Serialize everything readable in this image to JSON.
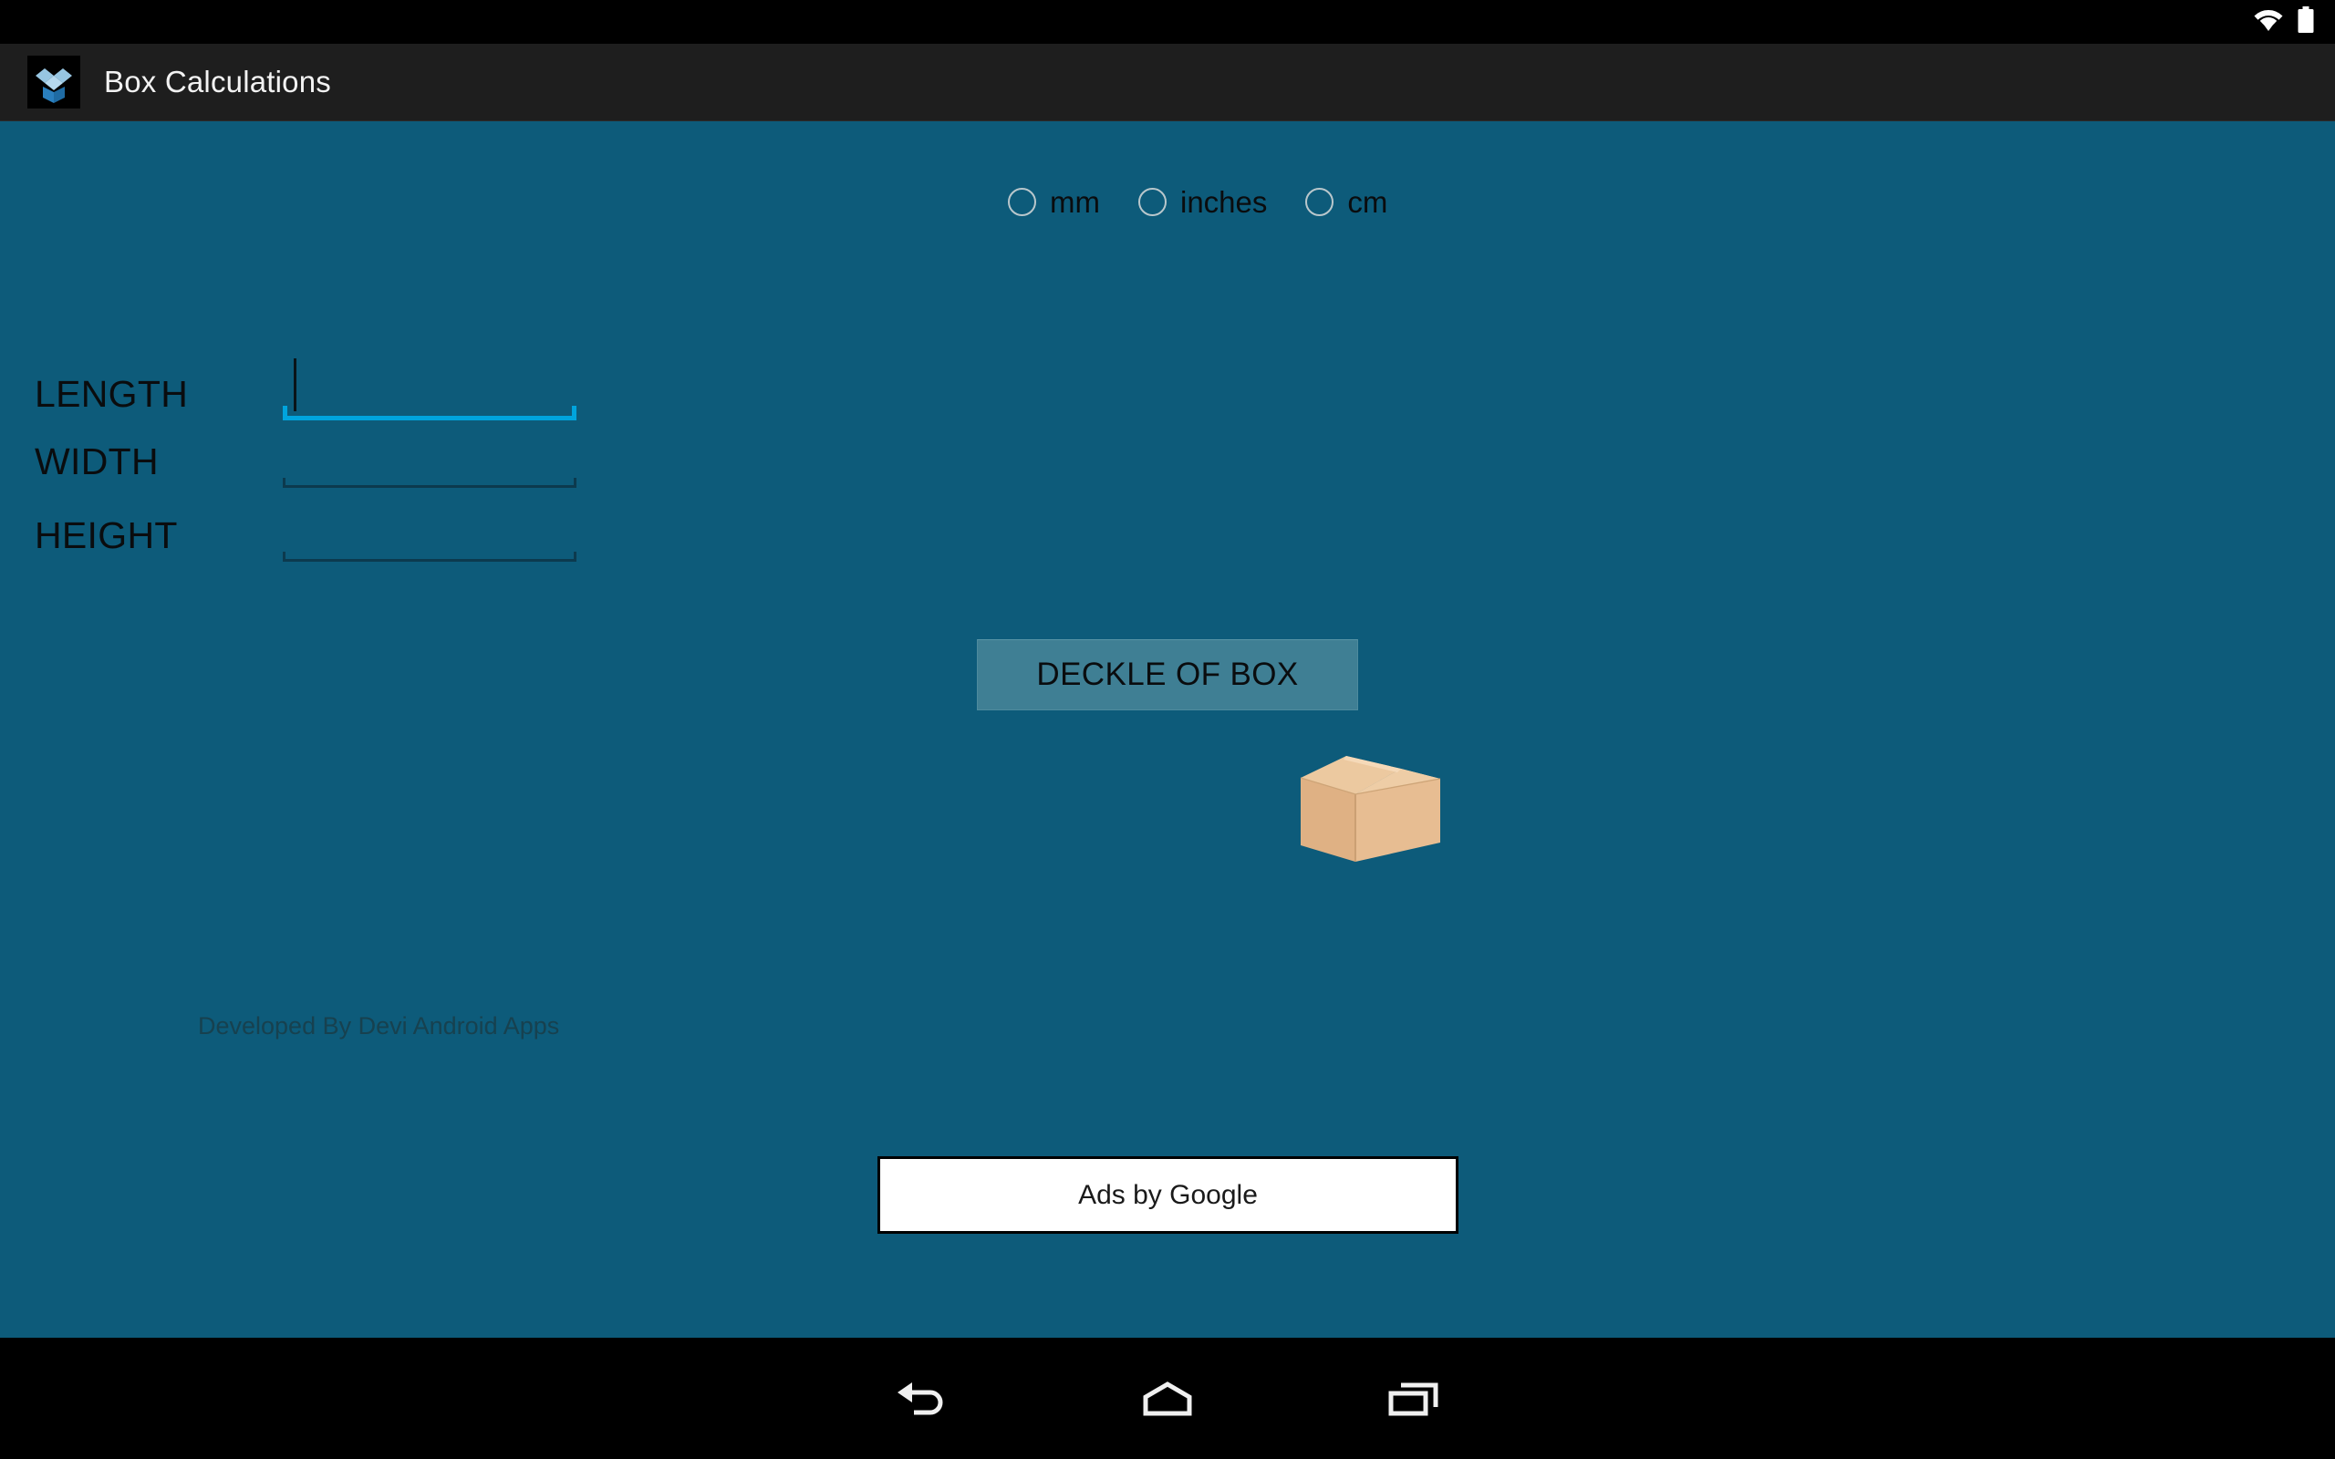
{
  "status_bar": {
    "wifi_icon": "wifi-icon",
    "battery_icon": "battery-full-icon"
  },
  "action_bar": {
    "app_icon": "open-box-app-icon",
    "title": "Box Calculations"
  },
  "units": {
    "options": [
      {
        "label": "mm",
        "name": "radio-mm",
        "selected": false
      },
      {
        "label": "inches",
        "name": "radio-inches",
        "selected": false
      },
      {
        "label": "cm",
        "name": "radio-cm",
        "selected": false
      }
    ]
  },
  "fields": [
    {
      "label": "LENGTH",
      "value": "",
      "placeholder": "",
      "focused": true
    },
    {
      "label": "WIDTH",
      "value": "",
      "placeholder": "",
      "focused": false
    },
    {
      "label": "HEIGHT",
      "value": "",
      "placeholder": "",
      "focused": false
    }
  ],
  "actions": {
    "deckle_button_label": "DECKLE OF BOX"
  },
  "illustration": {
    "name": "cardboard-box-image"
  },
  "footer": {
    "developer_credit": "Developed By Devi Android Apps"
  },
  "ad": {
    "label": "Ads by Google"
  },
  "nav_bar": {
    "back": "back-icon",
    "home": "home-icon",
    "recents": "recent-apps-icon"
  },
  "colors": {
    "background": "#0d5b7a",
    "action_bar": "#1e1e1e",
    "status_bar": "#000000",
    "accent_focus": "#00a4dd",
    "underline_idle": "#0c3a4e",
    "button": "#3f7f94",
    "text_dark": "#0a0c0e",
    "credit_text": "#17414f",
    "box_face": "#e0b486",
    "box_top": "#f0cfa8",
    "box_side": "#d9a877"
  }
}
